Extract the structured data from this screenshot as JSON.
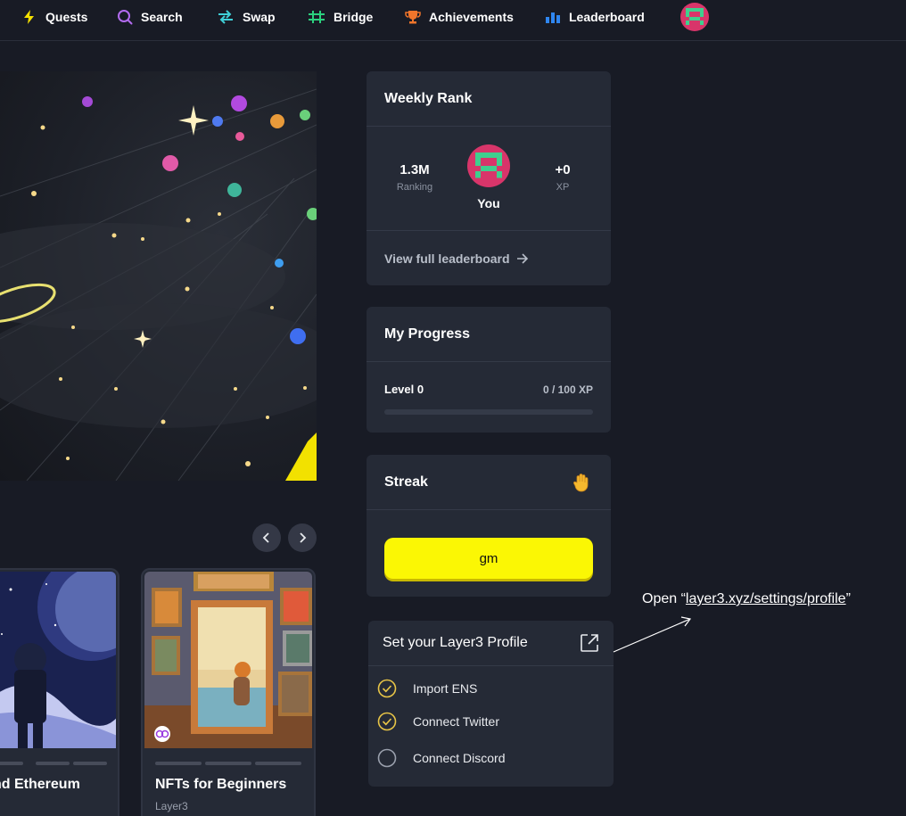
{
  "nav": {
    "items": [
      {
        "label": "Quests",
        "icon": "lightning-icon"
      },
      {
        "label": "Search",
        "icon": "search-icon"
      },
      {
        "label": "Swap",
        "icon": "swap-arrows-icon"
      },
      {
        "label": "Bridge",
        "icon": "bridge-icon"
      },
      {
        "label": "Achievements",
        "icon": "trophy-icon"
      },
      {
        "label": "Leaderboard",
        "icon": "bar-chart-icon"
      }
    ]
  },
  "quests": {
    "cards": [
      {
        "title": "nd Ethereum",
        "subtitle": ""
      },
      {
        "title": "NFTs for Beginners",
        "subtitle": "Layer3"
      }
    ]
  },
  "weekly_rank": {
    "title": "Weekly Rank",
    "ranking_value": "1.3M",
    "ranking_label": "Ranking",
    "you_label": "You",
    "xp_value": "+0",
    "xp_label": "XP",
    "view_link": "View full leaderboard"
  },
  "my_progress": {
    "title": "My Progress",
    "level": "Level 0",
    "xp": "0 / 100 XP",
    "progress_fraction": 0
  },
  "streak": {
    "title": "Streak",
    "button": "gm",
    "icon": "waving-hand-icon"
  },
  "profile": {
    "title": "Set your Layer3 Profile",
    "items": [
      {
        "label": "Import ENS",
        "done": true
      },
      {
        "label": "Connect Twitter",
        "done": true
      },
      {
        "label": "Connect Discord",
        "done": false
      }
    ]
  },
  "annotation": {
    "prefix": "Open “",
    "link": "layer3.xyz/settings/profile",
    "suffix": "”"
  },
  "colors": {
    "background": "#181b25",
    "card": "#252a36",
    "accent_yellow": "#fbf704",
    "check_yellow": "#e8c547"
  }
}
